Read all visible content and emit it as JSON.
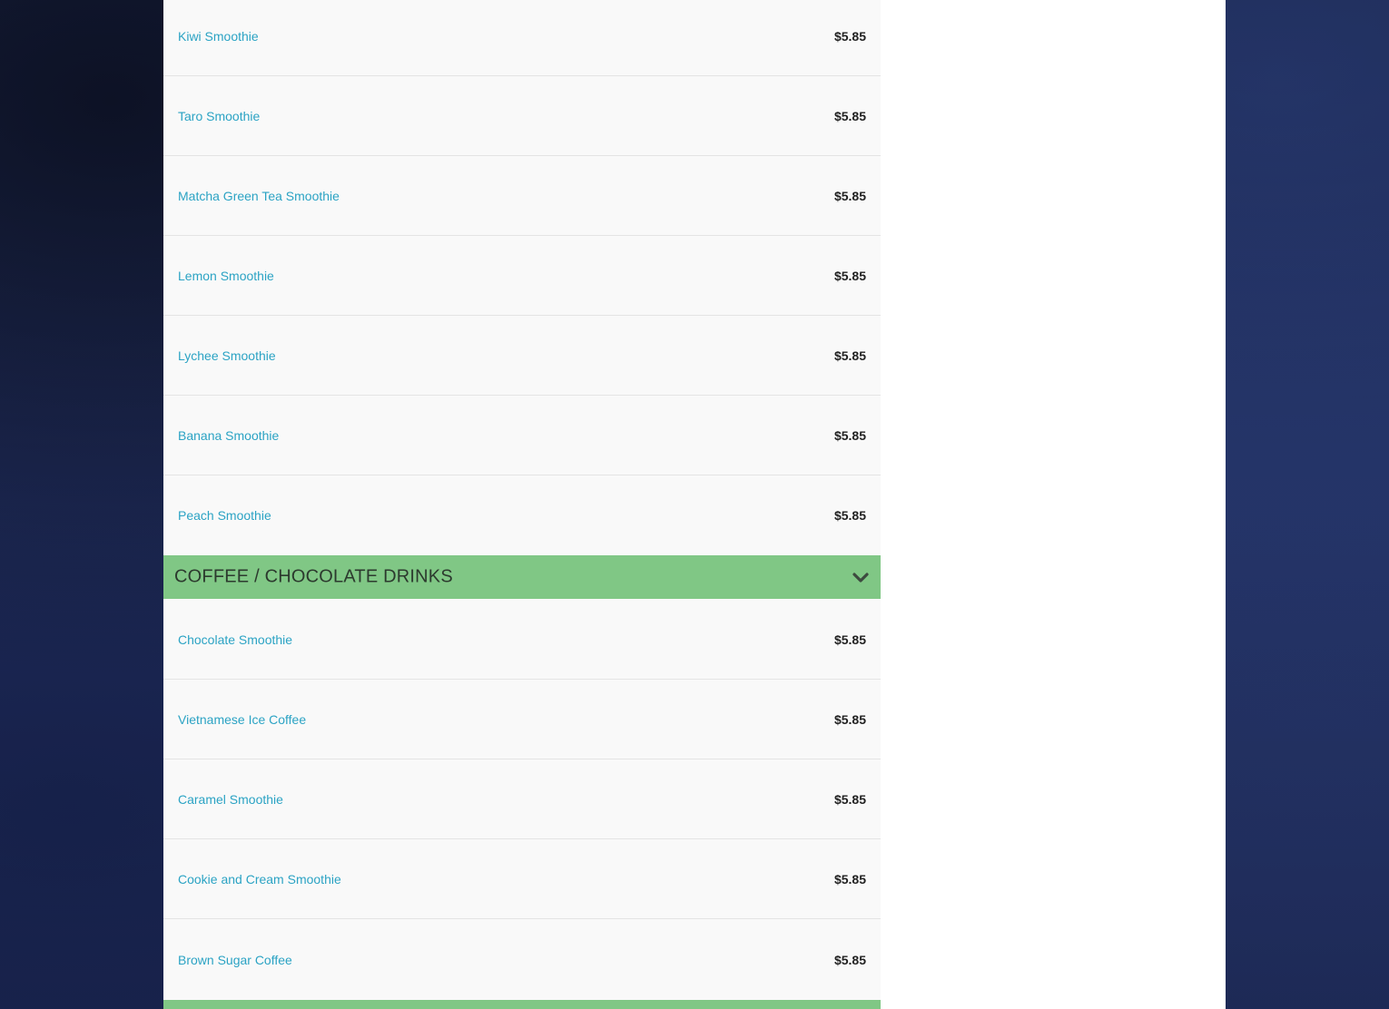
{
  "section_top": {
    "items": [
      {
        "name": "Kiwi Smoothie",
        "price": "$5.85"
      },
      {
        "name": "Taro Smoothie",
        "price": "$5.85"
      },
      {
        "name": "Matcha Green Tea Smoothie",
        "price": "$5.85"
      },
      {
        "name": "Lemon Smoothie",
        "price": "$5.85"
      },
      {
        "name": "Lychee Smoothie",
        "price": "$5.85"
      },
      {
        "name": "Banana Smoothie",
        "price": "$5.85"
      },
      {
        "name": "Peach Smoothie",
        "price": "$5.85"
      }
    ]
  },
  "category": {
    "title": "COFFEE / CHOCOLATE DRINKS",
    "icon": "chevron-down-icon",
    "color": "#80c785"
  },
  "section_coffee": {
    "items": [
      {
        "name": "Chocolate Smoothie",
        "price": "$5.85"
      },
      {
        "name": "Vietnamese Ice Coffee",
        "price": "$5.85"
      },
      {
        "name": "Caramel Smoothie",
        "price": "$5.85"
      },
      {
        "name": "Cookie and Cream Smoothie",
        "price": "$5.85"
      },
      {
        "name": "Brown Sugar Coffee",
        "price": "$5.85"
      }
    ]
  },
  "colors": {
    "item_name": "#2ba3c4",
    "price": "#222222",
    "category_bar": "#80c785"
  }
}
